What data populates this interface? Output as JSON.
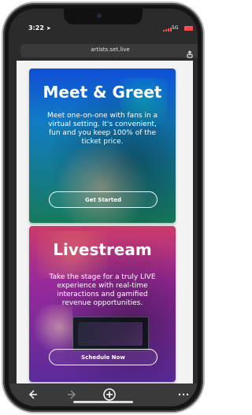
{
  "status": {
    "time": "3:22",
    "network": "5G"
  },
  "browser": {
    "url": "artists.set.live"
  },
  "cards": [
    {
      "title": "Meet & Greet",
      "body": "Meet one-on-one with fans in a virtual setting. It's convenient, fun and you keep 100% of the ticket price.",
      "button": "Get Started"
    },
    {
      "title": "Livestream",
      "body": "Take the stage for a truly LIVE experience with real-time interactions and gamified revenue opportunities.",
      "button": "Schedule Now"
    }
  ],
  "icons": {
    "back": "back-arrow-icon",
    "forward": "forward-arrow-icon",
    "new_tab": "plus-circle-icon",
    "more": "more-dots-icon",
    "share": "share-icon",
    "location": "location-arrow-icon"
  },
  "colors": {
    "card1_top": "#0f4fd7",
    "card1_bottom": "#177a5c",
    "card2_top": "#cc3b69",
    "card2_bottom": "#5a2b9a",
    "battery": "#ff4d4d"
  }
}
